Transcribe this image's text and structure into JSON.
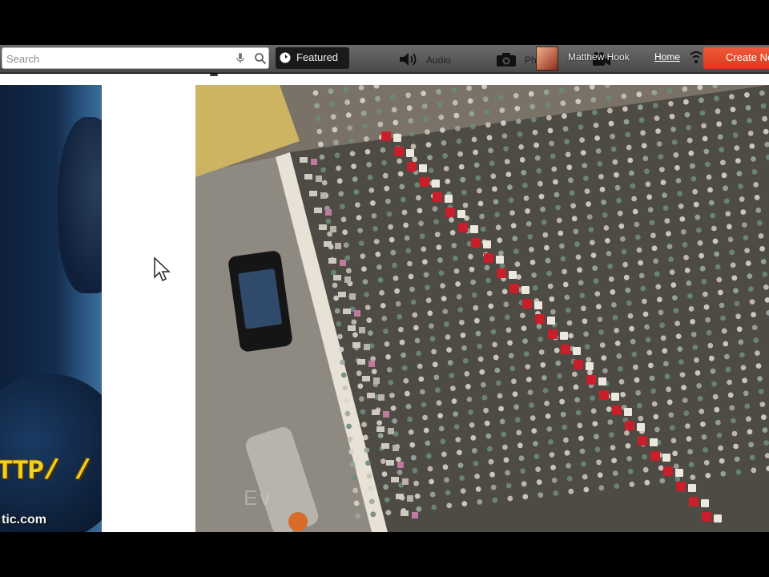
{
  "search": {
    "placeholder": "Search",
    "value": ""
  },
  "toolbar": {
    "featured_label": "Featured",
    "audio_label": "Audio",
    "photo_label": "Ph",
    "username": "Matthew Hook",
    "home_label": "Home",
    "create_label": "Create New"
  },
  "webcam": {
    "overlay_text_1": "TTP/ /",
    "overlay_text_2": "tic.com"
  },
  "photo": {
    "watermark": "Ev"
  },
  "colors": {
    "toolbar": "#5a5a5a",
    "create_button": "#e0452a",
    "featured_button": "#1a1a1a",
    "overlay_text": "#f0d020"
  },
  "icons": [
    "mic-icon",
    "search-icon",
    "featured-icon",
    "audio-icon",
    "camera-icon",
    "video-icon",
    "wifi-icon",
    "cursor-icon"
  ]
}
